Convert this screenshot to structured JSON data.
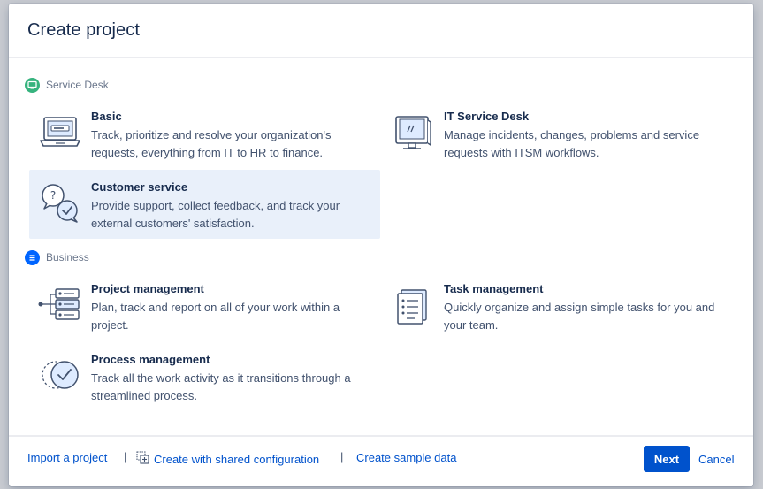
{
  "dialog": {
    "title": "Create project"
  },
  "sections": {
    "service_desk": {
      "label": "Service Desk",
      "icon": "monitor-icon",
      "color": "#36b37e",
      "options": {
        "basic": {
          "title": "Basic",
          "description": "Track, prioritize and resolve your organization's requests, everything from IT to HR to finance.",
          "icon": "laptop-icon"
        },
        "it_service_desk": {
          "title": "IT Service Desk",
          "description": "Manage incidents, changes, problems and service requests with ITSM workflows.",
          "icon": "monitor-icon"
        },
        "customer_service": {
          "title": "Customer service",
          "description": "Provide support, collect feedback, and track your external customers' satisfaction.",
          "icon": "chat-bubbles-icon",
          "selected": true
        }
      }
    },
    "business": {
      "label": "Business",
      "icon": "list-icon",
      "color": "#0065ff",
      "options": {
        "project_management": {
          "title": "Project management",
          "description": "Plan, track and report on all of your work within a project.",
          "icon": "workflow-icon"
        },
        "task_management": {
          "title": "Task management",
          "description": "Quickly organize and assign simple tasks for you and your team.",
          "icon": "checklist-icon"
        },
        "process_management": {
          "title": "Process management",
          "description": "Track all the work activity as it transitions through a streamlined process.",
          "icon": "check-circle-icon"
        }
      }
    }
  },
  "footer": {
    "import_label": "Import a project",
    "separator": "|",
    "shared_config_label": "Create with shared configuration",
    "shared_config_icon": "copy-plus-icon",
    "sample_data_label": "Create sample data",
    "next_label": "Next",
    "cancel_label": "Cancel"
  },
  "colors": {
    "primary": "#0052cc",
    "selected_bg": "#e9f0fa",
    "icon_stroke": "#42526e",
    "icon_fill": "#deebff"
  }
}
